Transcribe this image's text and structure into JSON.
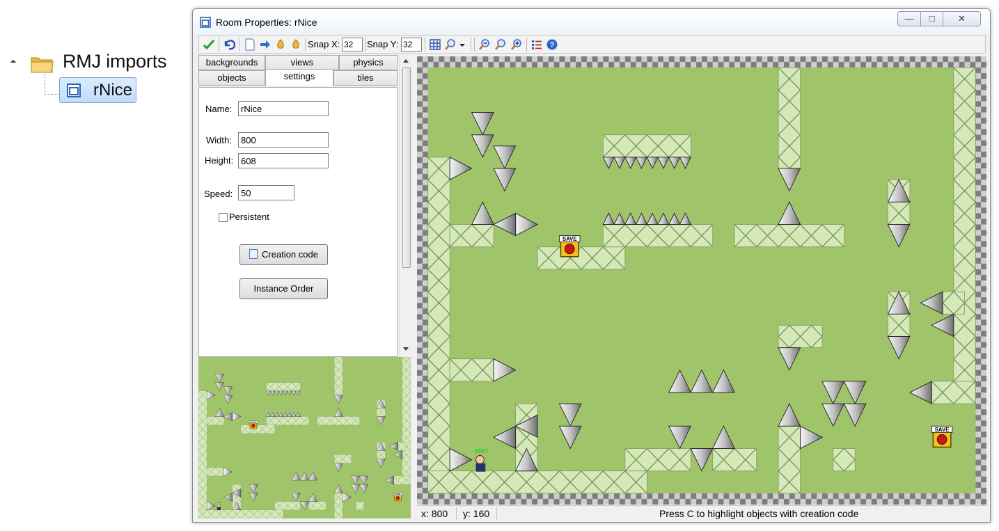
{
  "tree": {
    "folder_label": "RMJ imports",
    "room_label": "rNice"
  },
  "window": {
    "title": "Room Properties: rNice",
    "minimize": "—",
    "maximize": "□",
    "close": "✕"
  },
  "toolbar": {
    "snap_x_label": "Snap X:",
    "snap_x_value": "32",
    "snap_y_label": "Snap Y:",
    "snap_y_value": "32",
    "icons": [
      "ok-check-icon",
      "undo-icon",
      "clear-icon",
      "shift-icon",
      "sort-x-icon",
      "sort-y-icon",
      "grid-icon",
      "show-icon",
      "zoom-out-icon",
      "zoom-reset-icon",
      "zoom-in-icon",
      "settings-icon",
      "help-icon"
    ]
  },
  "tabs": {
    "row1": [
      "backgrounds",
      "views",
      "physics"
    ],
    "row2": [
      "objects",
      "settings",
      "tiles"
    ],
    "active": "settings"
  },
  "settings": {
    "name_label": "Name:",
    "name_value": "rNice",
    "width_label": "Width:",
    "width_value": "800",
    "height_label": "Height:",
    "height_value": "608",
    "speed_label": "Speed:",
    "speed_value": "50",
    "persistent_label": "Persistent",
    "persistent_checked": false,
    "creation_code_label": "Creation code",
    "instance_order_label": "Instance Order"
  },
  "room": {
    "save_label": "SAVE",
    "start_label": "start",
    "colors": {
      "grass": "#a0c46a",
      "tile": "#d4e8b8",
      "border_dark": "#7d7d7d",
      "border_light": "#cfcfcf"
    }
  },
  "status": {
    "x": "x: 800",
    "y": "y: 160",
    "message": "Press C to highlight objects with creation code"
  }
}
